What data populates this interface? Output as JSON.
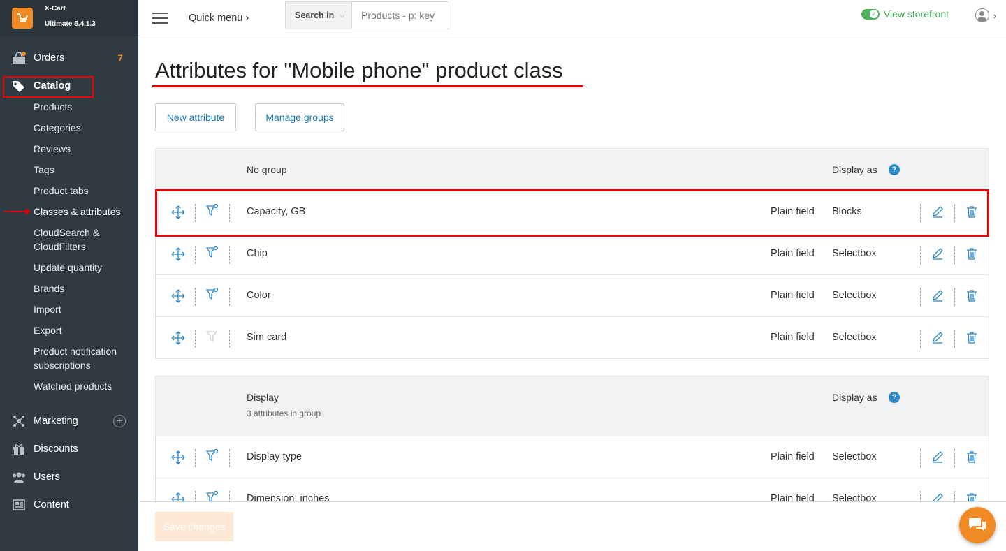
{
  "brand": {
    "name": "X-Cart",
    "edition": "Ultimate 5.4.1.3"
  },
  "sidebar": {
    "orders": {
      "label": "Orders",
      "badge": "7"
    },
    "catalog": {
      "label": "Catalog"
    },
    "catalog_items": [
      {
        "label": "Products"
      },
      {
        "label": "Categories"
      },
      {
        "label": "Reviews"
      },
      {
        "label": "Tags"
      },
      {
        "label": "Product tabs"
      },
      {
        "label": "Classes & attributes"
      },
      {
        "label": "CloudSearch & CloudFilters"
      },
      {
        "label": "Update quantity"
      },
      {
        "label": "Brands"
      },
      {
        "label": "Import"
      },
      {
        "label": "Export"
      },
      {
        "label": "Product notification subscriptions"
      },
      {
        "label": "Watched products"
      }
    ],
    "marketing": {
      "label": "Marketing"
    },
    "discounts": {
      "label": "Discounts"
    },
    "users": {
      "label": "Users"
    },
    "content": {
      "label": "Content"
    }
  },
  "topbar": {
    "quick_menu": "Quick menu",
    "search_in": "Search in",
    "search_placeholder": "Products - p: key",
    "view_storefront": "View storefront"
  },
  "page": {
    "title": "Attributes for \"Mobile phone\" product class",
    "new_attribute": "New attribute",
    "manage_groups": "Manage groups",
    "save_changes": "Save changes"
  },
  "groups": [
    {
      "name": "No group",
      "subtitle": "",
      "display_as_header": "Display as",
      "rows": [
        {
          "name": "Capacity, GB",
          "type": "Plain field",
          "display": "Blocks"
        },
        {
          "name": "Chip",
          "type": "Plain field",
          "display": "Selectbox"
        },
        {
          "name": "Color",
          "type": "Plain field",
          "display": "Selectbox"
        },
        {
          "name": "Sim card",
          "type": "Plain field",
          "display": "Selectbox"
        }
      ]
    },
    {
      "name": "Display",
      "subtitle": "3 attributes in group",
      "display_as_header": "Display as",
      "rows": [
        {
          "name": "Display type",
          "type": "Plain field",
          "display": "Selectbox"
        },
        {
          "name": "Dimension, inches",
          "type": "Plain field",
          "display": "Selectbox"
        }
      ]
    }
  ],
  "colors": {
    "accent": "#2a87c8",
    "brand": "#f08a24",
    "highlight": "#ee0000",
    "sidebar": "#2f3a42"
  }
}
